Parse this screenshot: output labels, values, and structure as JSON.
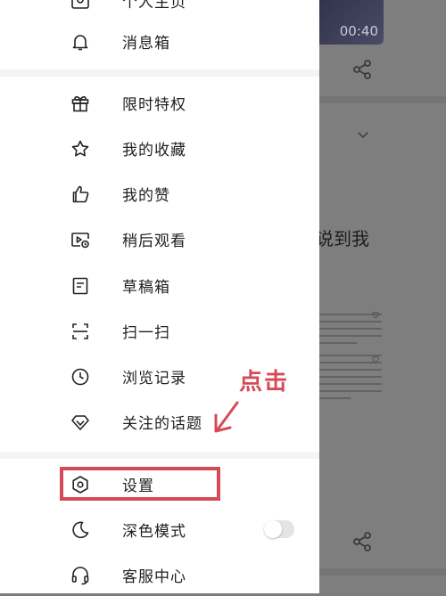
{
  "video": {
    "duration": "00:40"
  },
  "background": {
    "title_fragment": "说到我"
  },
  "menu": {
    "items": [
      {
        "id": "profile",
        "label": "个人主页"
      },
      {
        "id": "inbox",
        "label": "消息箱"
      },
      {
        "id": "offers",
        "label": "限时特权"
      },
      {
        "id": "favorites",
        "label": "我的收藏"
      },
      {
        "id": "likes",
        "label": "我的赞"
      },
      {
        "id": "watch_later",
        "label": "稍后观看"
      },
      {
        "id": "drafts",
        "label": "草稿箱"
      },
      {
        "id": "scan",
        "label": "扫一扫"
      },
      {
        "id": "history",
        "label": "浏览记录"
      },
      {
        "id": "topics",
        "label": "关注的话题"
      },
      {
        "id": "settings",
        "label": "设置"
      },
      {
        "id": "dark_mode",
        "label": "深色模式"
      },
      {
        "id": "support",
        "label": "客服中心"
      }
    ]
  },
  "dark_mode": {
    "enabled": false
  },
  "annotation": {
    "text": "点击",
    "color": "#d64a57"
  }
}
